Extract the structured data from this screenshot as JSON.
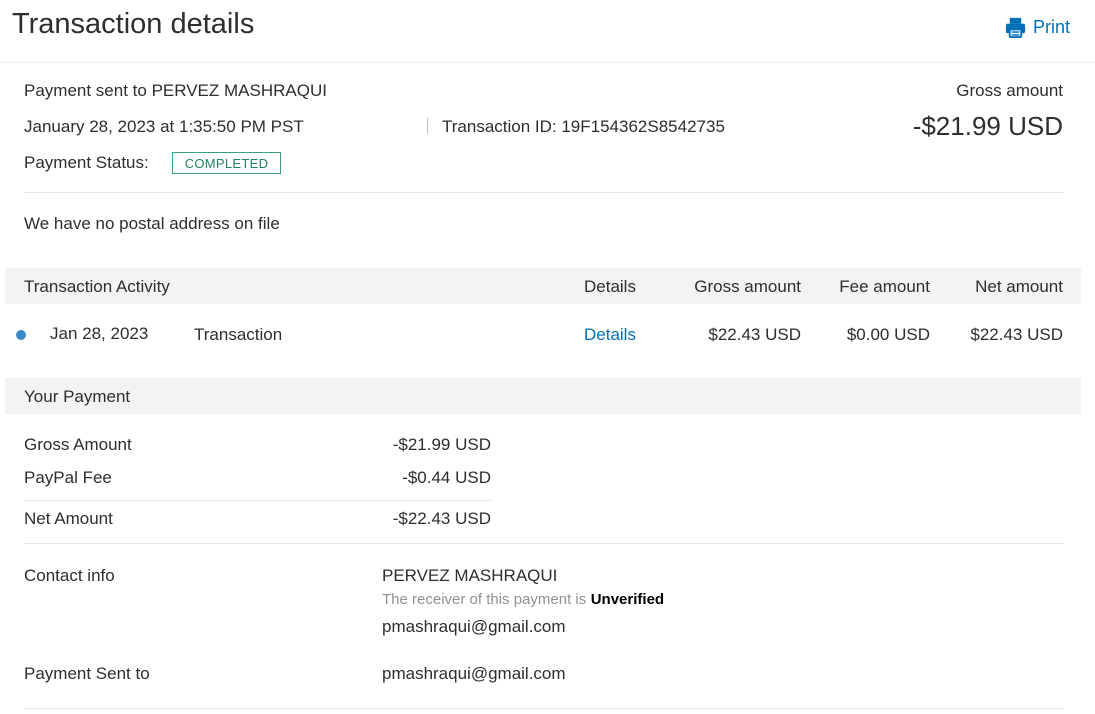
{
  "header": {
    "title": "Transaction details",
    "print_label": "Print",
    "print_icon": "printer-icon"
  },
  "summary": {
    "payment_sent_to": "Payment sent to PERVEZ MASHRAQUI",
    "datetime": "January 28, 2023 at 1:35:50 PM PST",
    "transaction_id": "Transaction ID: 19F154362S8542735",
    "status_label": "Payment Status:",
    "status_value": "COMPLETED",
    "gross_label": "Gross amount",
    "gross_value": "-$21.99 USD"
  },
  "address_note": "We have no postal address on file",
  "activity": {
    "headers": {
      "activity": "Transaction Activity",
      "details": "Details",
      "gross": "Gross amount",
      "fee": "Fee amount",
      "net": "Net amount"
    },
    "rows": [
      {
        "date": "Jan 28, 2023",
        "type": "Transaction",
        "details": "Details",
        "gross": "$22.43 USD",
        "fee": "$0.00 USD",
        "net": "$22.43 USD"
      }
    ]
  },
  "your_payment": {
    "title": "Your Payment",
    "lines": [
      {
        "label": "Gross Amount",
        "value": "-$21.99 USD"
      },
      {
        "label": "PayPal Fee",
        "value": "-$0.44 USD"
      },
      {
        "label": "Net Amount",
        "value": "-$22.43 USD"
      }
    ]
  },
  "contact": {
    "label": "Contact info",
    "name": "PERVEZ MASHRAQUI",
    "verify_text": "The receiver of this payment is",
    "verify_status": "Unverified",
    "email": "pmashraqui@gmail.com"
  },
  "sent_to": {
    "label": "Payment Sent to",
    "value": "pmashraqui@gmail.com"
  },
  "colors": {
    "link": "#0070ba",
    "status_border": "#3d9c7c",
    "dot": "#3889c9",
    "band": "#f1f3f5"
  }
}
